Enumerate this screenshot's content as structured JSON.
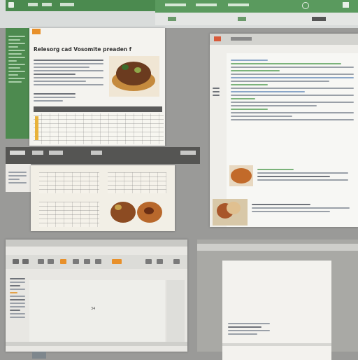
{
  "top_window": {
    "title": "Relesorg cad Vosomite preaden fod"
  },
  "middle_window": {
    "cursor_label": "34"
  },
  "icons": {
    "menu": "hamburger-icon",
    "tile": "food-photo-icon",
    "toolbar": [
      "undo-icon",
      "redo-icon",
      "bold-icon",
      "italic-icon",
      "image-icon",
      "table-icon",
      "orange-tool-icon",
      "orange-tool-icon",
      "link-icon",
      "search-icon"
    ]
  },
  "colors": {
    "green_ribbon": "#4b8a4f",
    "orange_accent": "#e8902a",
    "background": "#9a9a98"
  }
}
